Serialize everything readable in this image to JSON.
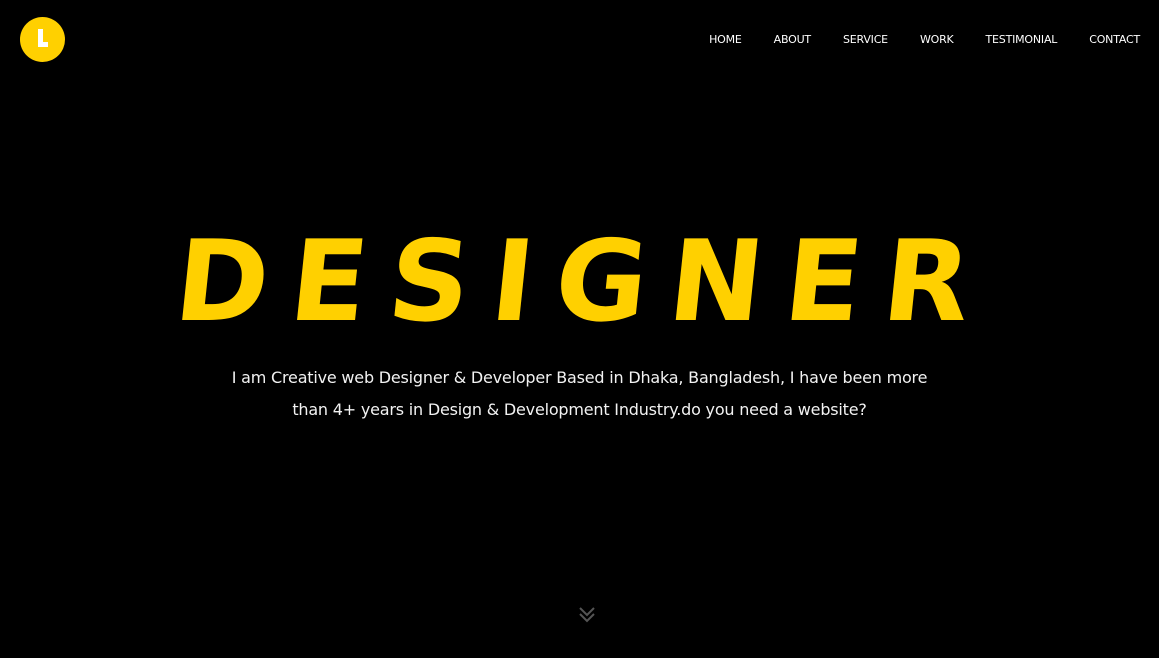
{
  "brand": {
    "logo_letter": "L",
    "accent_color": "#ffd000"
  },
  "nav": {
    "items": [
      {
        "label": "HOME"
      },
      {
        "label": "ABOUT"
      },
      {
        "label": "SERVICE"
      },
      {
        "label": "WORK"
      },
      {
        "label": "TESTIMONIAL"
      },
      {
        "label": "CONTACT"
      }
    ]
  },
  "hero": {
    "headline": "DESIGNER",
    "tagline_line1": "I am Creative web Designer & Developer Based in Dhaka, Bangladesh, I have been more",
    "tagline_line2": "than 4+ years in Design & Development Industry.do you need a website?"
  },
  "icons": {
    "scroll": "chevron-double-down-icon"
  }
}
